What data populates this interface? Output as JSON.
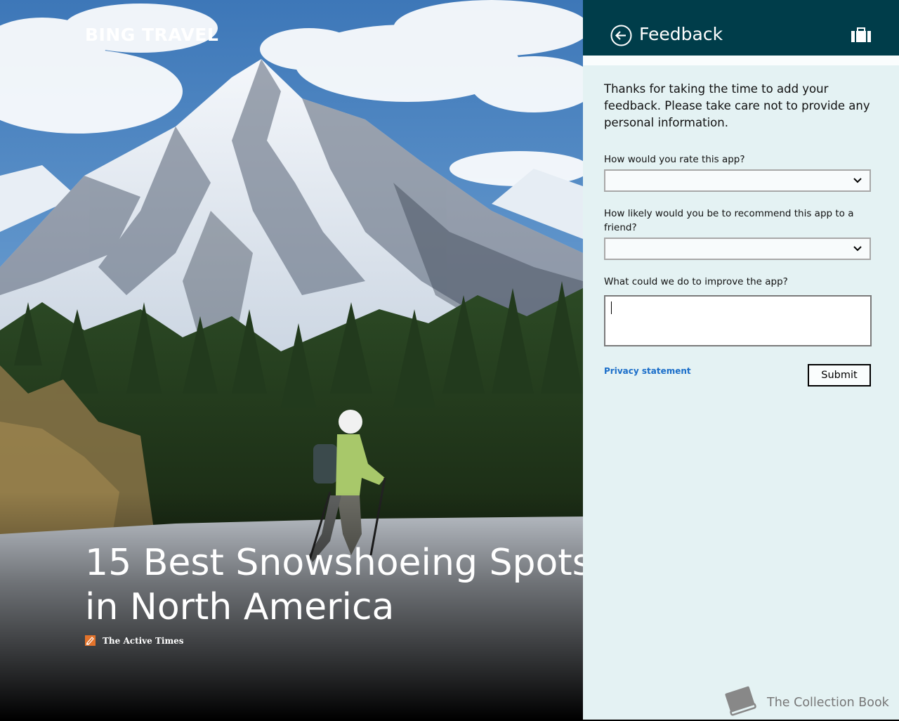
{
  "app": {
    "title": "BING TRAVEL"
  },
  "article": {
    "headline": "15 Best Snowshoeing Spots in North America",
    "source": "The Active Times"
  },
  "feedback": {
    "title": "Feedback",
    "intro": "Thanks for taking the time to add your feedback. Please take care not to provide any personal information.",
    "rate_label": "How would you rate this app?",
    "rate_value": "",
    "recommend_label": "How likely would you be to recommend this app to a friend?",
    "recommend_value": "",
    "improve_label": "What could we do to improve the app?",
    "improve_value": "",
    "privacy_link": "Privacy statement",
    "submit_label": "Submit"
  },
  "watermark": {
    "text": "The Collection Book"
  },
  "colors": {
    "header_bg": "#003d4a",
    "panel_bg": "#e4f2f3",
    "link": "#1b6ec9",
    "source_icon": "#e3732b"
  },
  "icons": {
    "back": "back-arrow-icon",
    "bag": "briefcase-icon",
    "dropdown": "chevron-down-icon",
    "source": "source-logo-icon",
    "watermark": "book-icon"
  }
}
